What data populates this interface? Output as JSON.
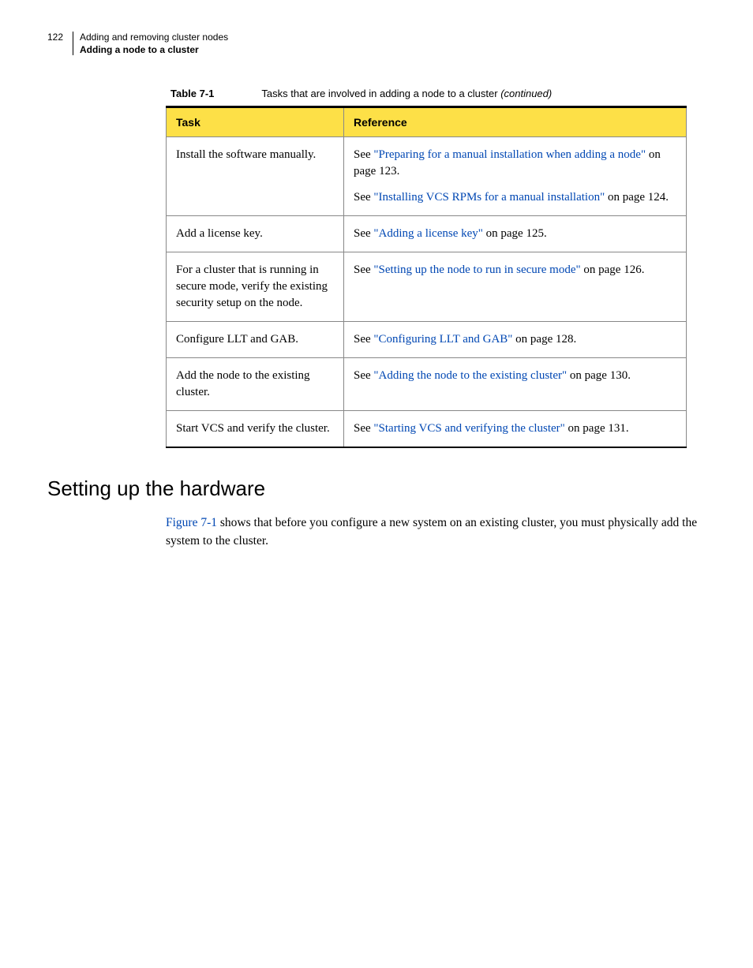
{
  "page_number": "122",
  "header": {
    "line1": "Adding and removing cluster nodes",
    "line2": "Adding a node to a cluster"
  },
  "table_caption": {
    "label": "Table 7-1",
    "text": "Tasks that are involved in adding a node to a cluster ",
    "suffix": "(continued)"
  },
  "columns": {
    "c1": "Task",
    "c2": "Reference"
  },
  "rows": [
    {
      "task": "Install the software manually.",
      "refs": [
        {
          "pre": "See ",
          "link": "\"Preparing for a manual installation when adding a node\"",
          "post": " on page 123."
        },
        {
          "pre": "See ",
          "link": "\"Installing VCS RPMs for a manual installation\"",
          "post": " on page 124."
        }
      ]
    },
    {
      "task": "Add a license key.",
      "refs": [
        {
          "pre": "See ",
          "link": "\"Adding a license key\"",
          "post": " on page 125."
        }
      ]
    },
    {
      "task": "For a cluster that is running in secure mode, verify the existing security setup on the node.",
      "refs": [
        {
          "pre": "See ",
          "link": "\"Setting up the node to run in secure mode\"",
          "post": " on page 126."
        }
      ]
    },
    {
      "task": "Configure LLT and GAB.",
      "refs": [
        {
          "pre": "See ",
          "link": "\"Configuring LLT and GAB\"",
          "post": " on page 128."
        }
      ]
    },
    {
      "task": "Add the node to the existing cluster.",
      "refs": [
        {
          "pre": "See ",
          "link": "\"Adding the node to the existing cluster\"",
          "post": " on page 130."
        }
      ]
    },
    {
      "task": "Start VCS and verify the cluster.",
      "refs": [
        {
          "pre": "See ",
          "link": "\"Starting VCS and verifying the cluster\"",
          "post": " on page 131."
        }
      ]
    }
  ],
  "section_title": "Setting up the hardware",
  "body": {
    "fig_link": "Figure 7-1",
    "rest": " shows that before you configure a new system on an existing cluster, you must physically add the system to the cluster."
  }
}
